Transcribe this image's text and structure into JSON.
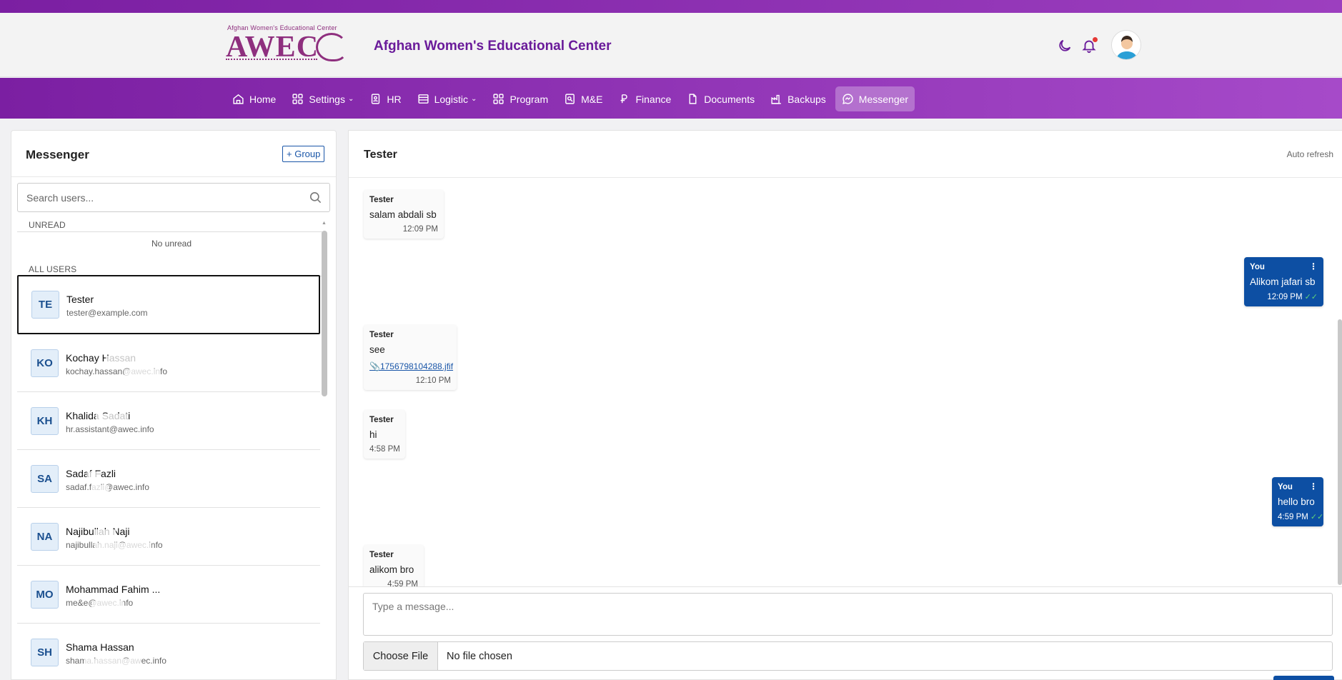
{
  "header": {
    "logo_tagline": "Afghan Women's Educational Center",
    "logo_mark": "AWEC",
    "brand_title": "Afghan Women's Educational Center"
  },
  "nav": {
    "items": [
      {
        "label": "Home",
        "icon": "home-icon"
      },
      {
        "label": "Settings",
        "icon": "grid-icon",
        "dropdown": true
      },
      {
        "label": "HR",
        "icon": "id-card-icon"
      },
      {
        "label": "Logistic",
        "icon": "table-icon",
        "dropdown": true
      },
      {
        "label": "Program",
        "icon": "apps-icon"
      },
      {
        "label": "M&E",
        "icon": "monitor-icon"
      },
      {
        "label": "Finance",
        "icon": "currency-icon"
      },
      {
        "label": "Documents",
        "icon": "file-icon"
      },
      {
        "label": "Backups",
        "icon": "building-icon"
      },
      {
        "label": "Messenger",
        "icon": "chat-icon",
        "active": true
      }
    ]
  },
  "sidebar": {
    "title": "Messenger",
    "group_button": "+ Group",
    "search_placeholder": "Search users...",
    "unread_label": "UNREAD",
    "no_unread": "No unread",
    "all_users_label": "ALL USERS",
    "users": [
      {
        "initials": "TE",
        "name": "Tester",
        "email": "tester@example.com",
        "selected": true
      },
      {
        "initials": "KO",
        "name": "Kochay Hassan",
        "email": "kochay.hassan@awec.info"
      },
      {
        "initials": "KH",
        "name": "Khalida Sadati",
        "email": "hr.assistant@awec.info"
      },
      {
        "initials": "SA",
        "name": "Sadaf Fazli",
        "email": "sadaf.fazli@awec.info"
      },
      {
        "initials": "NA",
        "name": "Najibullah Naji",
        "email": "najibullah.naji@awec.info"
      },
      {
        "initials": "MO",
        "name": "Mohammad Fahim ...",
        "email": "me&e@awec.info"
      },
      {
        "initials": "SH",
        "name": "Shama Hassan",
        "email": "shama.hassan@awec.info"
      }
    ]
  },
  "chat": {
    "title": "Tester",
    "auto_refresh": "Auto refresh",
    "messages": [
      {
        "direction": "in",
        "sender": "Tester",
        "text": "salam abdali sb",
        "time": "12:09 PM"
      },
      {
        "direction": "out",
        "sender": "You",
        "text": "Alikom jafari sb",
        "time": "12:09 PM"
      },
      {
        "direction": "in",
        "sender": "Tester",
        "text": "see",
        "attachment": "1756798104288.jfif",
        "time": "12:10 PM"
      },
      {
        "direction": "in",
        "sender": "Tester",
        "text": "hi",
        "time": "4:58 PM"
      },
      {
        "direction": "out",
        "sender": "You",
        "text": "hello bro",
        "time": "4:59 PM"
      },
      {
        "direction": "in",
        "sender": "Tester",
        "text": "alikom bro",
        "time": "4:59 PM"
      }
    ],
    "input_placeholder": "Type a message...",
    "file_button": "Choose File",
    "file_status": "No file chosen"
  },
  "colors": {
    "brand_purple": "#7b1fa2",
    "logo_purple": "#8e2f7e",
    "outgoing_bubble": "#0d4fa3",
    "notification_dot": "#e53935"
  }
}
